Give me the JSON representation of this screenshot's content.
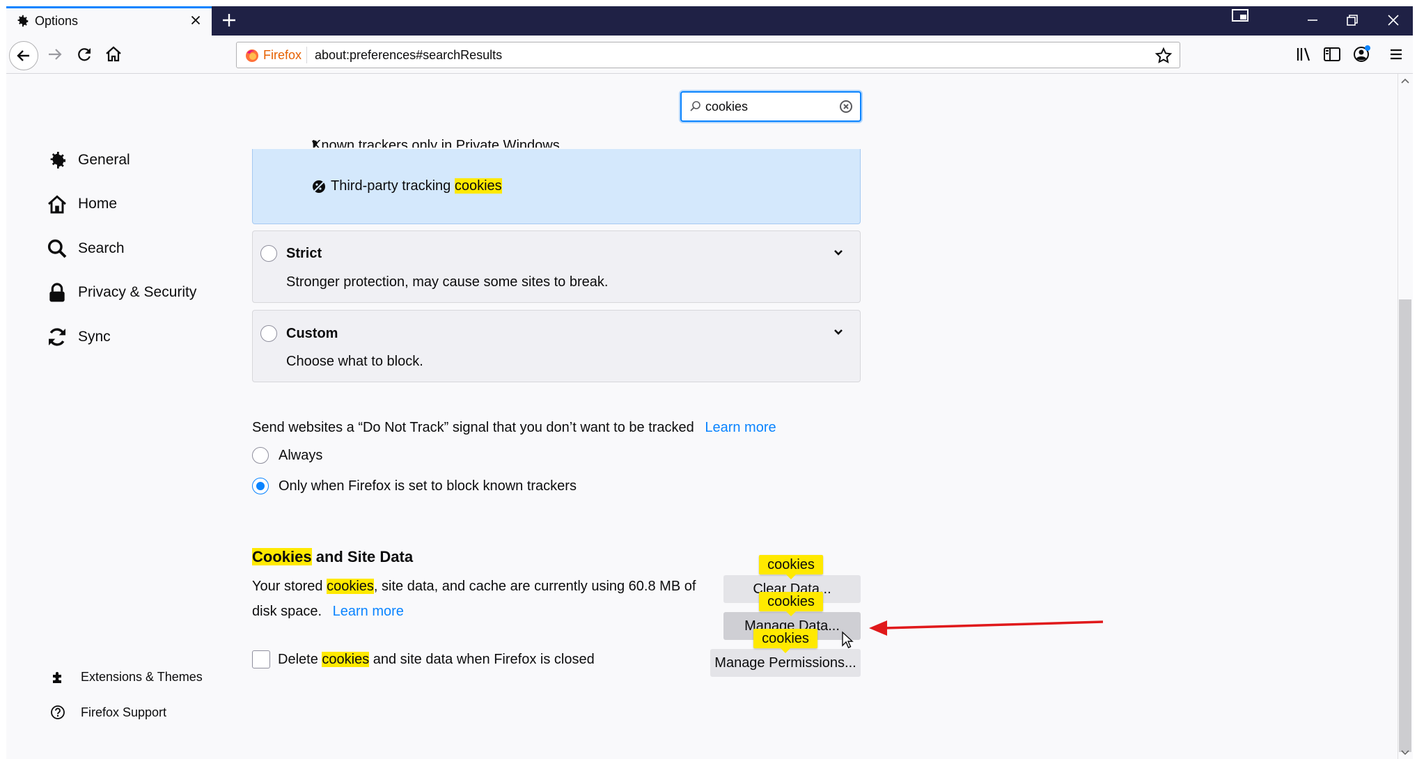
{
  "tab": {
    "title": "Options"
  },
  "urlbar": {
    "brand": "Firefox",
    "url": "about:preferences#searchResults"
  },
  "search": {
    "value": "cookies"
  },
  "sidebar": {
    "items": [
      {
        "label": "General",
        "icon": "gear-icon"
      },
      {
        "label": "Home",
        "icon": "home-icon"
      },
      {
        "label": "Search",
        "icon": "search-icon"
      },
      {
        "label": "Privacy & Security",
        "icon": "lock-icon"
      },
      {
        "label": "Sync",
        "icon": "sync-icon"
      }
    ],
    "footer": [
      {
        "label": "Extensions & Themes",
        "icon": "puzzle-icon"
      },
      {
        "label": "Firefox Support",
        "icon": "help-icon"
      }
    ]
  },
  "standard": {
    "item_cut": "Known trackers only in Private Windows",
    "item_prefix": "Third-party tracking ",
    "item_highlight": "cookies"
  },
  "strict": {
    "title": "Strict",
    "desc": "Stronger protection, may cause some sites to break."
  },
  "custom": {
    "title": "Custom",
    "desc": "Choose what to block."
  },
  "dnt": {
    "text": "Send websites a “Do Not Track” signal that you don’t want to be tracked",
    "learn_more": "Learn more",
    "options": [
      {
        "label": "Always",
        "selected": false
      },
      {
        "label": "Only when Firefox is set to block known trackers",
        "selected": true
      }
    ]
  },
  "cookies_section": {
    "title_highlight": "Cookies",
    "title_rest": " and Site Data",
    "desc_before": "Your stored ",
    "desc_highlight": "cookies",
    "desc_after": ", site data, and cache are currently using 60.8 MB of",
    "desc_line2": "disk space.",
    "learn_more": "Learn more",
    "clear_button": "Clear Data...",
    "manage_button": "Manage Data...",
    "permissions_button": "Manage Permissions...",
    "tooltip": "cookies",
    "delete_prefix": "Delete ",
    "delete_highlight": "cookies",
    "delete_suffix": " and site data when Firefox is closed",
    "delete_checked": false
  },
  "colors": {
    "accent": "#0a84ff",
    "highlight": "#ffe900",
    "tabbar": "#1f2145",
    "annotation_arrow": "#e0191b"
  }
}
